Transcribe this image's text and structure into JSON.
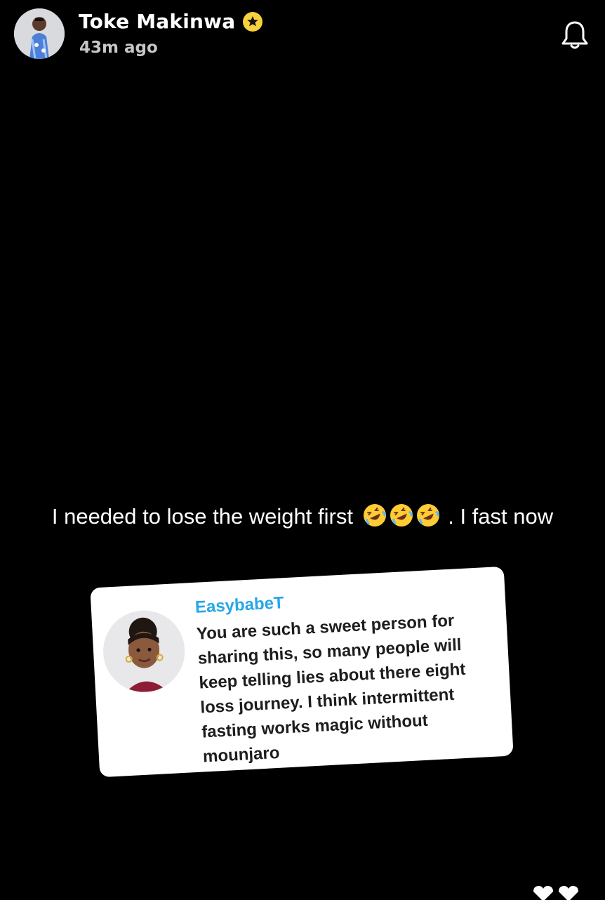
{
  "story": {
    "user": {
      "name": "Toke Makinwa",
      "time": "43m ago",
      "verified_icon": "star-badge-icon",
      "avatar_icon": "profile-avatar"
    },
    "caption": {
      "before_emoji": "I needed to lose the weight first",
      "emoji": [
        "rolling-on-floor-laughing-emoji",
        "rolling-on-floor-laughing-emoji",
        "rolling-on-floor-laughing-emoji"
      ],
      "after_emoji": ". I fast now"
    },
    "reply_sticker": {
      "username": "EasybabeT",
      "message": "You are such a sweet person for sharing this, so many people will keep telling lies about there eight loss journey. I think intermittent fasting works magic without mounjaro"
    },
    "actions": {
      "notification_icon": "bell-icon"
    },
    "colors": {
      "background": "#000000",
      "accent_username": "#27a7e7",
      "badge": "#f6d23c"
    }
  }
}
